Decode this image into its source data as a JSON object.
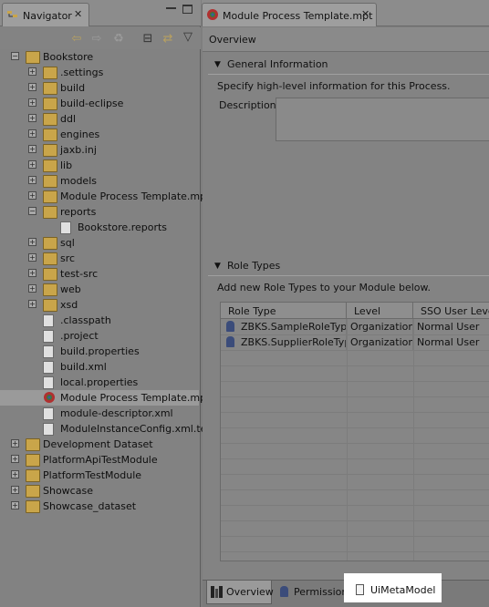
{
  "navigator": {
    "tab_label": "Navigator",
    "close_glyph": "✕",
    "toolbar_icons": [
      "back-arrow-icon",
      "forward-arrow-icon",
      "up-folder-icon",
      "collapse-all-icon",
      "link-editor-icon",
      "view-menu-icon"
    ],
    "tree": [
      {
        "label": "Bookstore",
        "level": 0,
        "kind": "project",
        "expander": "−"
      },
      {
        "label": ".settings",
        "level": 1,
        "kind": "folder",
        "expander": "+"
      },
      {
        "label": "build",
        "level": 1,
        "kind": "folder",
        "expander": "+"
      },
      {
        "label": "build-eclipse",
        "level": 1,
        "kind": "folder",
        "expander": "+"
      },
      {
        "label": "ddl",
        "level": 1,
        "kind": "folder",
        "expander": "+"
      },
      {
        "label": "engines",
        "level": 1,
        "kind": "folder",
        "expander": "+"
      },
      {
        "label": "jaxb.inj",
        "level": 1,
        "kind": "folder",
        "expander": "+"
      },
      {
        "label": "lib",
        "level": 1,
        "kind": "folder",
        "expander": "+"
      },
      {
        "label": "models",
        "level": 1,
        "kind": "folder",
        "expander": "+"
      },
      {
        "label": "Module Process Template.mpt.l",
        "level": 1,
        "kind": "folder",
        "expander": "+"
      },
      {
        "label": "reports",
        "level": 1,
        "kind": "folder",
        "expander": "−"
      },
      {
        "label": "Bookstore.reports",
        "level": 2,
        "kind": "file",
        "expander": ""
      },
      {
        "label": "sql",
        "level": 1,
        "kind": "folder",
        "expander": "+"
      },
      {
        "label": "src",
        "level": 1,
        "kind": "folder",
        "expander": "+"
      },
      {
        "label": "test-src",
        "level": 1,
        "kind": "folder",
        "expander": "+"
      },
      {
        "label": "web",
        "level": 1,
        "kind": "folder",
        "expander": "+"
      },
      {
        "label": "xsd",
        "level": 1,
        "kind": "folder",
        "expander": "+"
      },
      {
        "label": ".classpath",
        "level": 1,
        "kind": "file",
        "expander": ""
      },
      {
        "label": ".project",
        "level": 1,
        "kind": "file",
        "expander": ""
      },
      {
        "label": "build.properties",
        "level": 1,
        "kind": "file",
        "expander": ""
      },
      {
        "label": "build.xml",
        "level": 1,
        "kind": "file",
        "expander": ""
      },
      {
        "label": "local.properties",
        "level": 1,
        "kind": "file",
        "expander": ""
      },
      {
        "label": "Module Process Template.mpt",
        "level": 1,
        "kind": "mpt",
        "expander": "",
        "selected": true
      },
      {
        "label": "module-descriptor.xml",
        "level": 1,
        "kind": "file",
        "expander": ""
      },
      {
        "label": "ModuleInstanceConfig.xml.tem",
        "level": 1,
        "kind": "file",
        "expander": ""
      },
      {
        "label": "Development Dataset",
        "level": 0,
        "kind": "project",
        "expander": "+"
      },
      {
        "label": "PlatformApiTestModule",
        "level": 0,
        "kind": "project",
        "expander": "+"
      },
      {
        "label": "PlatformTestModule",
        "level": 0,
        "kind": "project",
        "expander": "+"
      },
      {
        "label": "Showcase",
        "level": 0,
        "kind": "project",
        "expander": "+"
      },
      {
        "label": "Showcase_dataset",
        "level": 0,
        "kind": "project",
        "expander": "+"
      }
    ]
  },
  "editor": {
    "tab_label": "Module Process Template.mpt",
    "close_glyph": "✕",
    "overview_title": "Overview",
    "general": {
      "title": "General Information",
      "description": "Specify high-level information for this Process.",
      "description_label": "Description:"
    },
    "roles": {
      "title": "Role Types",
      "description": "Add new Role Types to your Module below.",
      "columns": [
        "Role Type",
        "Level",
        "SSO User Level"
      ],
      "rows": [
        [
          "ZBKS.SampleRoleType",
          "Organization",
          "Normal User"
        ],
        [
          "ZBKS.SupplierRoleType",
          "Organization",
          "Normal User"
        ]
      ]
    },
    "bottom_tabs": [
      "Overview",
      "Permissions",
      "UiMetaModel"
    ]
  },
  "colors": {
    "highlight": "#ffffff",
    "dim_background": "#7e7e7e"
  }
}
